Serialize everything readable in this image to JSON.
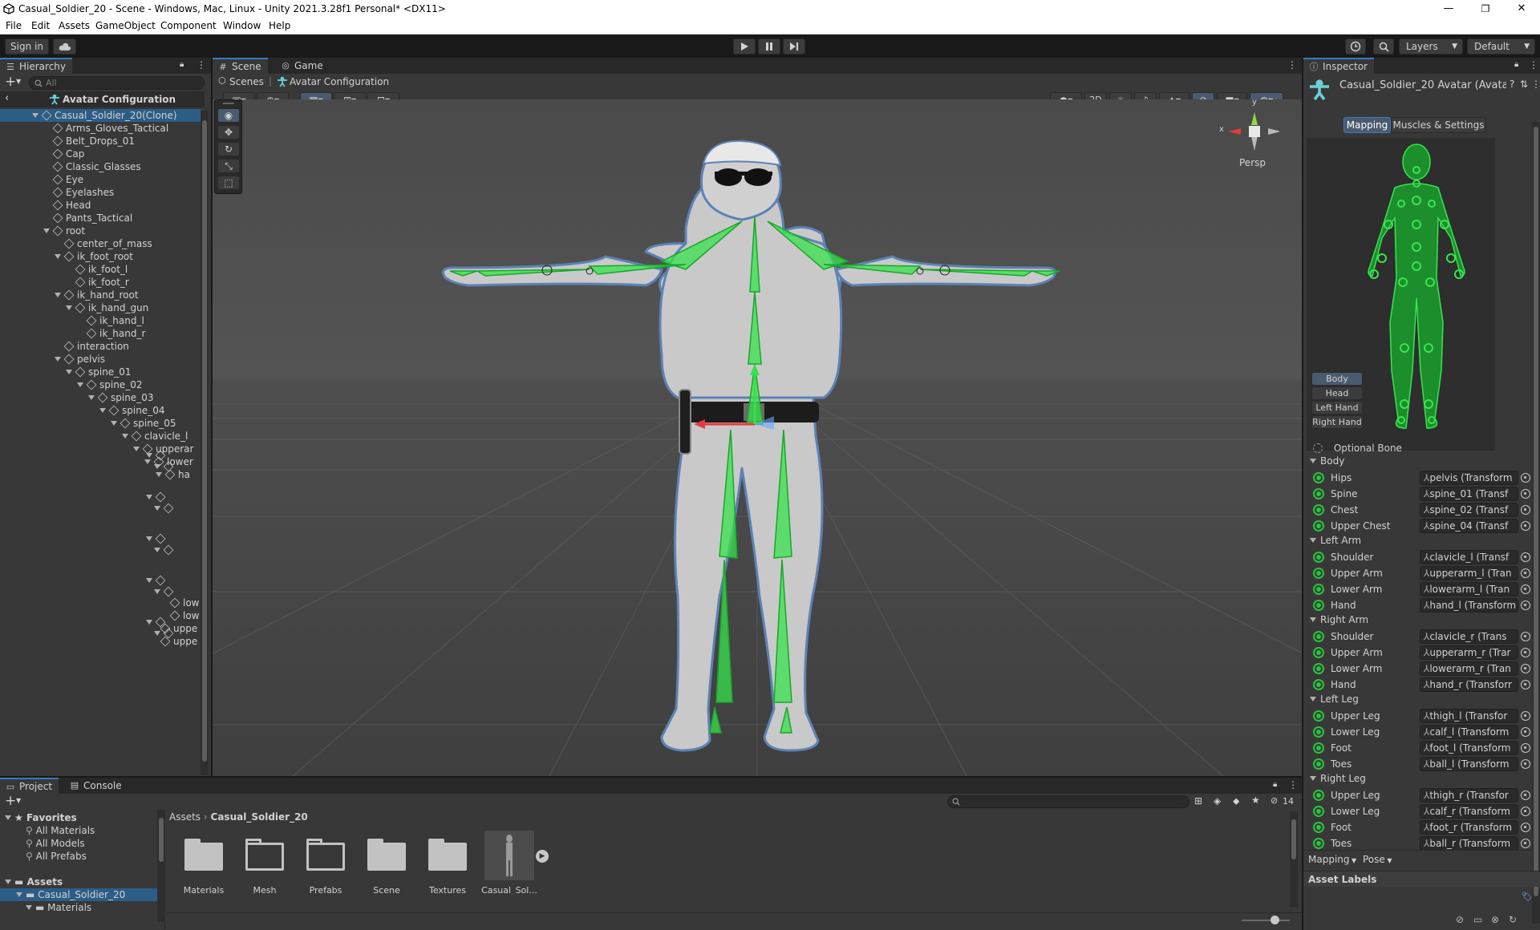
{
  "window": {
    "title": "Casual_Soldier_20 - Scene - Windows, Mac, Linux - Unity 2021.3.28f1 Personal* <DX11>",
    "controls": [
      "—",
      "❐",
      "✕"
    ]
  },
  "menu": [
    "File",
    "Edit",
    "Assets",
    "GameObject",
    "Component",
    "Window",
    "Help"
  ],
  "toolbar": {
    "sign_in": "Sign in",
    "layers": "Layers",
    "layout": "Default"
  },
  "hierarchy": {
    "tab": "Hierarchy",
    "search_placeholder": "All",
    "context": "Avatar Configuration",
    "rows": [
      {
        "label": "Casual_Soldier_20(Clone)",
        "depth": 0,
        "expand": true,
        "selected": true
      },
      {
        "label": "Arms_Gloves_Tactical",
        "depth": 1,
        "expand": false
      },
      {
        "label": "Belt_Drops_01",
        "depth": 1,
        "expand": false
      },
      {
        "label": "Cap",
        "depth": 1,
        "expand": false
      },
      {
        "label": "Classic_Glasses",
        "depth": 1,
        "expand": false
      },
      {
        "label": "Eye",
        "depth": 1,
        "expand": false
      },
      {
        "label": "Eyelashes",
        "depth": 1,
        "expand": false
      },
      {
        "label": "Head",
        "depth": 1,
        "expand": false
      },
      {
        "label": "Pants_Tactical",
        "depth": 1,
        "expand": false
      },
      {
        "label": "root",
        "depth": 1,
        "expand": true
      },
      {
        "label": "center_of_mass",
        "depth": 2,
        "expand": false
      },
      {
        "label": "ik_foot_root",
        "depth": 2,
        "expand": true
      },
      {
        "label": "ik_foot_l",
        "depth": 3,
        "expand": false
      },
      {
        "label": "ik_foot_r",
        "depth": 3,
        "expand": false
      },
      {
        "label": "ik_hand_root",
        "depth": 2,
        "expand": true
      },
      {
        "label": "ik_hand_gun",
        "depth": 3,
        "expand": true
      },
      {
        "label": "ik_hand_l",
        "depth": 4,
        "expand": false
      },
      {
        "label": "ik_hand_r",
        "depth": 4,
        "expand": false
      },
      {
        "label": "interaction",
        "depth": 2,
        "expand": false
      },
      {
        "label": "pelvis",
        "depth": 2,
        "expand": true
      },
      {
        "label": "spine_01",
        "depth": 3,
        "expand": true
      },
      {
        "label": "spine_02",
        "depth": 4,
        "expand": true
      },
      {
        "label": "spine_03",
        "depth": 5,
        "expand": true
      },
      {
        "label": "spine_04",
        "depth": 6,
        "expand": true
      },
      {
        "label": "spine_05",
        "depth": 7,
        "expand": true
      },
      {
        "label": "clavicle_l",
        "depth": 8,
        "expand": true
      },
      {
        "label": "upperar",
        "depth": 9,
        "expand": true
      },
      {
        "label": "lower",
        "depth": 10,
        "expand": true
      },
      {
        "label": "ha",
        "depth": 11,
        "expand": true
      }
    ],
    "bottom_rows": [
      "low",
      "low",
      "uppe",
      "uppe"
    ]
  },
  "scene": {
    "tabs": [
      "Scene",
      "Game"
    ],
    "breadcrumb": [
      "Scenes",
      "Avatar Configuration"
    ],
    "mode_2d": "2D",
    "persp_label": "Persp",
    "gizmo_x": "x",
    "gizmo_y": "y"
  },
  "inspector": {
    "tab": "Inspector",
    "title": "Casual_Soldier_20 Avatar (Avata",
    "tabs": [
      "Mapping",
      "Muscles & Settings"
    ],
    "view_buttons": [
      "Body",
      "Head",
      "Left Hand",
      "Right Hand"
    ],
    "optional_bone": "Optional Bone",
    "groups": [
      {
        "name": "Body",
        "rows": [
          {
            "name": "Hips",
            "value": "pelvis (Transform"
          },
          {
            "name": "Spine",
            "value": "spine_01 (Transf"
          },
          {
            "name": "Chest",
            "value": "spine_02 (Transf"
          },
          {
            "name": "Upper Chest",
            "value": "spine_04 (Transf"
          }
        ]
      },
      {
        "name": "Left Arm",
        "rows": [
          {
            "name": "Shoulder",
            "value": "clavicle_l (Transf"
          },
          {
            "name": "Upper Arm",
            "value": "upperarm_l (Tran"
          },
          {
            "name": "Lower Arm",
            "value": "lowerarm_l (Tran"
          },
          {
            "name": "Hand",
            "value": "hand_l (Transform"
          }
        ]
      },
      {
        "name": "Right Arm",
        "rows": [
          {
            "name": "Shoulder",
            "value": "clavicle_r (Trans"
          },
          {
            "name": "Upper Arm",
            "value": "upperarm_r (Trar"
          },
          {
            "name": "Lower Arm",
            "value": "lowerarm_r (Tran"
          },
          {
            "name": "Hand",
            "value": "hand_r (Transforr"
          }
        ]
      },
      {
        "name": "Left Leg",
        "rows": [
          {
            "name": "Upper Leg",
            "value": "thigh_l (Transfor"
          },
          {
            "name": "Lower Leg",
            "value": "calf_l (Transform"
          },
          {
            "name": "Foot",
            "value": "foot_l (Transform"
          },
          {
            "name": "Toes",
            "value": "ball_l (Transform"
          }
        ]
      },
      {
        "name": "Right Leg",
        "rows": [
          {
            "name": "Upper Leg",
            "value": "thigh_r (Transfor"
          },
          {
            "name": "Lower Leg",
            "value": "calf_r (Transform"
          },
          {
            "name": "Foot",
            "value": "foot_r (Transform"
          },
          {
            "name": "Toes",
            "value": "ball_r (Transform"
          }
        ]
      }
    ],
    "mapping_dropdown": "Mapping",
    "pose_dropdown": "Pose",
    "asset_labels": "Asset Labels"
  },
  "project": {
    "tabs": [
      "Project",
      "Console"
    ],
    "favorites": {
      "label": "Favorites",
      "items": [
        "All Materials",
        "All Models",
        "All Prefabs"
      ]
    },
    "assets_label": "Assets",
    "tree": [
      "Casual_Soldier_20",
      "Materials"
    ],
    "breadcrumb": [
      "Assets",
      "Casual_Soldier_20"
    ],
    "hidden_count": "14",
    "items": [
      "Materials",
      "Mesh",
      "Prefabs",
      "Scene",
      "Textures",
      "Casual_Sol..."
    ]
  },
  "colors": {
    "accent": "#3a79bb",
    "bone_green": "#26c73b",
    "panel": "#383838",
    "selected_row": "#2c5d87"
  }
}
